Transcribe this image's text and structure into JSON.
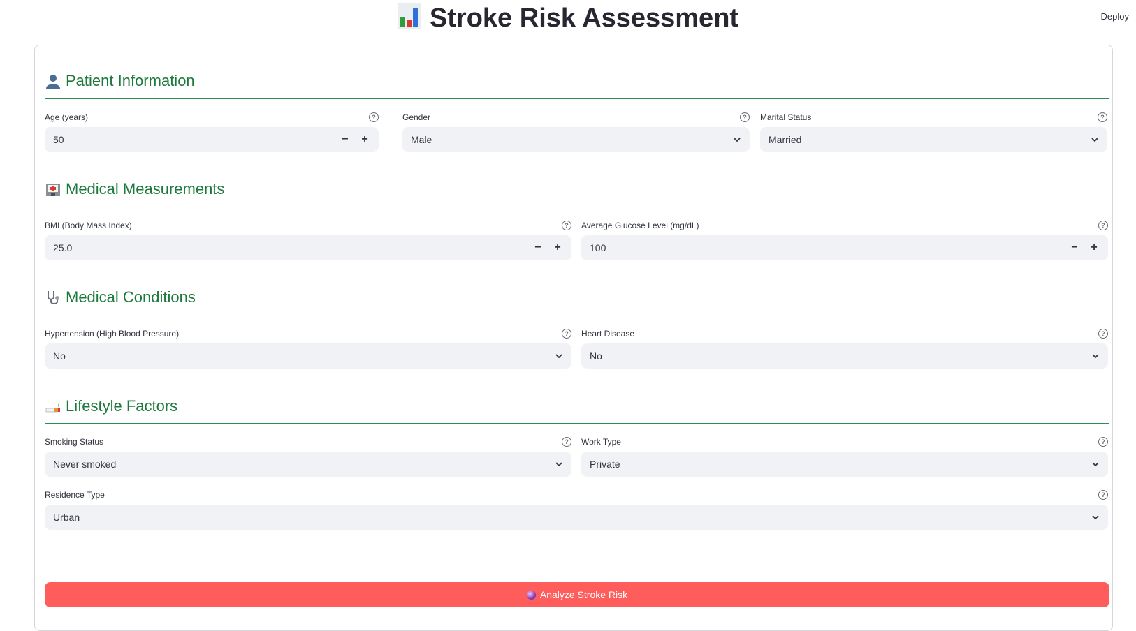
{
  "header": {
    "title": "Stroke Risk Assessment",
    "title_icon": "bar-chart-icon",
    "deploy_label": "Deploy"
  },
  "sections": {
    "patient": {
      "title": "Patient Information",
      "icon": "person-icon"
    },
    "measurements": {
      "title": "Medical Measurements",
      "icon": "hospital-icon"
    },
    "conditions": {
      "title": "Medical Conditions",
      "icon": "stethoscope-icon"
    },
    "lifestyle": {
      "title": "Lifestyle Factors",
      "icon": "cigarette-icon"
    }
  },
  "fields": {
    "age": {
      "label": "Age (years)",
      "value": "50"
    },
    "gender": {
      "label": "Gender",
      "value": "Male"
    },
    "marital": {
      "label": "Marital Status",
      "value": "Married"
    },
    "bmi": {
      "label": "BMI (Body Mass Index)",
      "value": "25.0"
    },
    "glucose": {
      "label": "Average Glucose Level (mg/dL)",
      "value": "100"
    },
    "hypertension": {
      "label": "Hypertension (High Blood Pressure)",
      "value": "No"
    },
    "heart": {
      "label": "Heart Disease",
      "value": "No"
    },
    "smoking": {
      "label": "Smoking Status",
      "value": "Never smoked"
    },
    "work": {
      "label": "Work Type",
      "value": "Private"
    },
    "residence": {
      "label": "Residence Type",
      "value": "Urban"
    }
  },
  "controls": {
    "help_glyph": "?",
    "minus": "−",
    "plus": "+"
  },
  "analyze_button": {
    "label": "Analyze Stroke Risk",
    "icon": "crystal-ball-icon"
  },
  "colors": {
    "accent_green": "#1e7a3c",
    "button_red": "#ff5c5c",
    "input_bg": "#f0f2f6"
  }
}
